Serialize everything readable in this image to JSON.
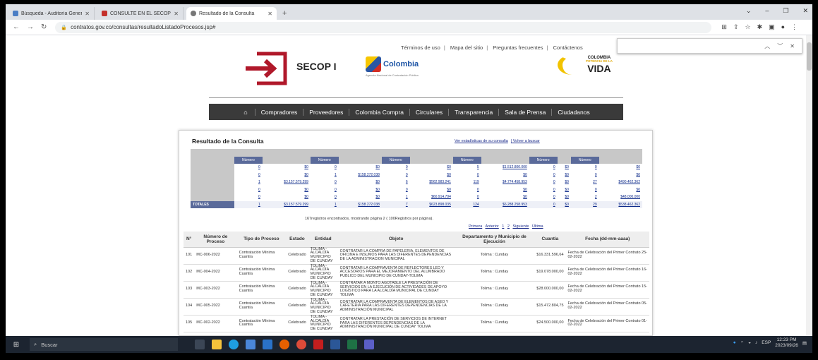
{
  "browser": {
    "tabs": [
      {
        "title": "Búsqueda - Auditoría General de"
      },
      {
        "title": "CONSULTE EN EL SECOP I | Colo"
      },
      {
        "title": "Resultado de la Consulta"
      }
    ],
    "url": "contratos.gov.co/consultas/resultadoListadoProcesos.jsp#",
    "new_tab_glyph": "+"
  },
  "header": {
    "links": [
      "Términos de uso",
      "Mapa del sitio",
      "Preguntas frecuentes",
      "Contáctenos"
    ],
    "secop_label": "SECOP I",
    "colombia_label": "Colombia",
    "colombia_sub": "Agencia Nacional de Contratación Pública",
    "potencia_top": "COLOMBIA",
    "potencia_mid": "POTENCIA DE LA",
    "potencia_big": "VIDA"
  },
  "nav": {
    "items": [
      "Compradores",
      "Proveedores",
      "Colombia Compra",
      "Circulares",
      "Transparencia",
      "Sala de Prensa",
      "Ciudadanos"
    ]
  },
  "result": {
    "title": "Resultado de la Consulta",
    "stats_link": "Ver estadísticas de su consulta",
    "back_link": "Volver a buscar",
    "stats_header_num": "Número",
    "stats_rows": [
      {
        "label": "",
        "cells": [
          "0",
          "$0",
          "0",
          "$0",
          "0",
          "$0",
          "5",
          "$1.512.800.000",
          "0",
          "$0",
          "0",
          "$0"
        ]
      },
      {
        "label": "",
        "cells": [
          "0",
          "$0",
          "1",
          "$158.272.038",
          "0",
          "$0",
          "0",
          "$0",
          "0",
          "$0",
          "0",
          "$0"
        ]
      },
      {
        "label": "",
        "cells": [
          "1",
          "$3.157.579.299",
          "0",
          "$0",
          "6",
          "$562.983.241",
          "119",
          "$4.774.458.953",
          "0",
          "$0",
          "27",
          "$490.462.362"
        ]
      },
      {
        "label": "",
        "cells": [
          "0",
          "$0",
          "0",
          "$0",
          "0",
          "$0",
          "0",
          "$0",
          "0",
          "$0",
          "0",
          "$0"
        ]
      },
      {
        "label": "",
        "cells": [
          "0",
          "$0",
          "0",
          "$0",
          "1",
          "$60.914.794",
          "0",
          "$0",
          "0",
          "$0",
          "2",
          "$48.000.000"
        ]
      }
    ],
    "stats_total": {
      "label": "TOTALES",
      "cells": [
        "1",
        "$3.157.579.299",
        "1",
        "$158.272.038",
        "7",
        "$623.898.035",
        "124",
        "$6.288.258.953",
        "0",
        "$0",
        "29",
        "$538.462.362"
      ]
    },
    "summary": "167registros encontrados, mostrando página 2 ( 100Registros por página).",
    "pager": [
      "Primera",
      "Anterior",
      "1",
      "2",
      "Siguiente",
      "Última"
    ],
    "columns": [
      "N°",
      "Número de Proceso",
      "Tipo de Proceso",
      "Estado",
      "Entidad",
      "Objeto",
      "Departamento y Municipio de Ejecución",
      "Cuantía",
      "Fecha (dd-mm-aaaa)"
    ],
    "rows": [
      {
        "n": "101",
        "proceso": "MC-006-2022",
        "tipo": "Contratación Mínima Cuantía",
        "estado": "Celebrado",
        "entidad": "TOLIMA - ALCALDÍA MUNICIPIO DE CUNDAY",
        "objeto": "CONTRATAR LA COMPRA DE PAPELERIA, ELEMENTOS DE OFICINA E INSUMOS PARA LAS DIFERENTES DEPENDENCIAS DE LA ADMINISTRACION MUNICIPAL",
        "depto": "Tolima : Cunday",
        "cuantia": "$16.331.596,64",
        "fecha": "Fecha de Celebración del Primer Contrato 25-02-2022"
      },
      {
        "n": "102",
        "proceso": "MC-004-2022",
        "tipo": "Contratación Mínima Cuantía",
        "estado": "Celebrado",
        "entidad": "TOLIMA - ALCALDÍA MUNICIPIO DE CUNDAY",
        "objeto": "CONTRATAR LA COMPRAVENTA DE REFLECTORES LED Y ACCESORIOS PARA EL MEJORAMIENTO DEL ALUMBRADO PUBLICO DEL MUNICIPIO DE CUNDAY-TOLIMA",
        "depto": "Tolima : Cunday",
        "cuantia": "$19.078.000,00",
        "fecha": "Fecha de Celebración del Primer Contrato 16-02-2022"
      },
      {
        "n": "103",
        "proceso": "MC-003-2022",
        "tipo": "Contratación Mínima Cuantía",
        "estado": "Celebrado",
        "entidad": "TOLIMA - ALCALDÍA MUNICIPIO DE CUNDAY",
        "objeto": "CONTRATAR A MONTO AGOTABLE LA PRESTACIÓN DE SERVICIOS EN LA EJECUCIÓN DE ACTIVIDADES DE APOYO LOGÍSTICO PARA LA ALCALDÍA MUNICIPAL DE CUNDAY TOLIMA",
        "depto": "Tolima : Cunday",
        "cuantia": "$28.000.000,00",
        "fecha": "Fecha de Celebración del Primer Contrato 15-02-2022"
      },
      {
        "n": "104",
        "proceso": "MC-005-2022",
        "tipo": "Contratación Mínima Cuantía",
        "estado": "Celebrado",
        "entidad": "TOLIMA - ALCALDÍA MUNICIPIO DE CUNDAY",
        "objeto": "CONTRATAR LA COMPRAVENTA DE ELEMENTOS DE ASEO Y CAFETERIA PARA LAS DIFERENTES DEPENDENCIAS DE LA ADMINISTRACIÓN MUNICIPAL",
        "depto": "Tolima : Cunday",
        "cuantia": "$15.472.804,75",
        "fecha": "Fecha de Celebración del Primer Contrato 05-02-2022"
      },
      {
        "n": "105",
        "proceso": "MC-002-2022",
        "tipo": "Contratación Mínima Cuantía",
        "estado": "Celebrado",
        "entidad": "TOLIMA - ALCALDÍA MUNICIPIO DE CUNDAY",
        "objeto": "CONTRATAR LA PRESTACIÓN DE SERVICIOS DE INTERNET PARA LAS DIFERENTES DEPENDENCIAS DE LA ADMINISTRACIÓN MUNICIPAL DE CUNDAY TOLIMA",
        "depto": "Tolima : Cunday",
        "cuantia": "$24.500.000,00",
        "fecha": "Fecha de Celebración del Primer Contrato 01-02-2022"
      }
    ]
  },
  "taskbar": {
    "search_placeholder": "Buscar",
    "lang": "ESP",
    "time": "12:23 PM",
    "date": "2023/09/26"
  },
  "colors": {
    "nav_bg": "#3a3a3a",
    "brand_red": "#b0182a",
    "brand_blue": "#1f56a6",
    "table_header": "#5a6a9a"
  }
}
